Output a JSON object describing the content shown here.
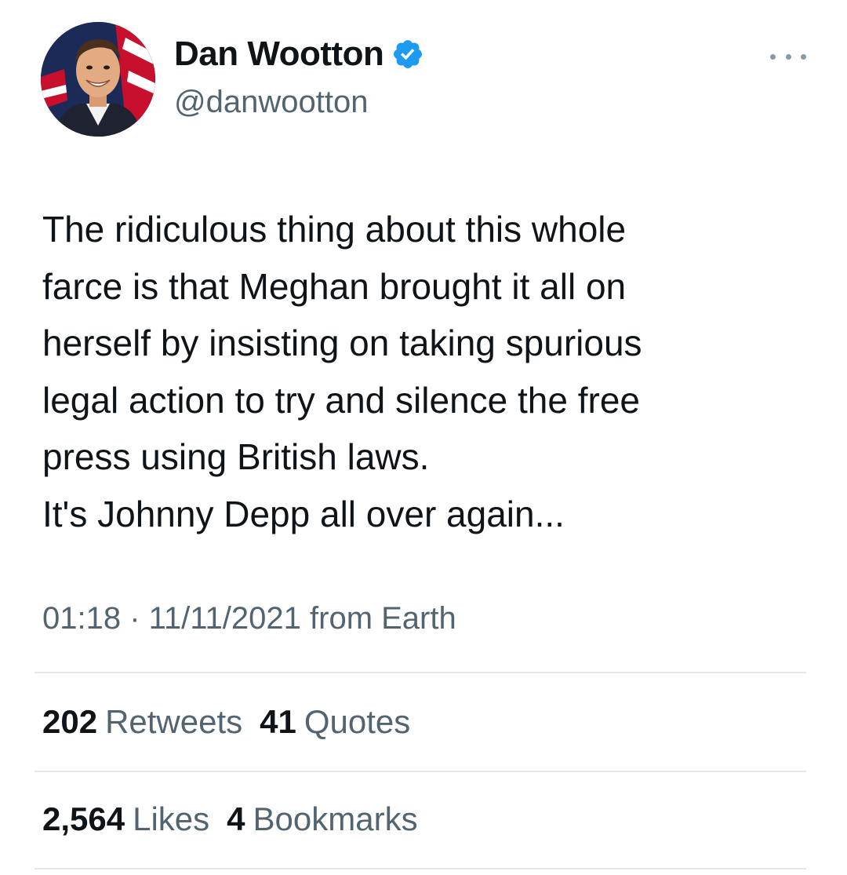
{
  "author": {
    "display_name": "Dan Wootton",
    "handle": "@danwootton",
    "verified": true,
    "verified_color": "#1d9bf0"
  },
  "tweet": {
    "text": "The ridiculous thing about this whole\nfarce is that Meghan brought it all on\nherself by insisting on taking spurious\nlegal action to try and silence the free\npress using British laws.\nIt's Johnny Depp all over again...",
    "meta": "01:18 · 11/11/2021 from Earth"
  },
  "stats": {
    "retweets": {
      "count": "202",
      "label": "Retweets"
    },
    "quotes": {
      "count": "41",
      "label": "Quotes"
    },
    "likes": {
      "count": "2,564",
      "label": "Likes"
    },
    "bookmarks": {
      "count": "4",
      "label": "Bookmarks"
    }
  },
  "icons": {
    "avatar": "profile-avatar",
    "verified": "verified-badge-icon",
    "more": "more-options-icon"
  }
}
